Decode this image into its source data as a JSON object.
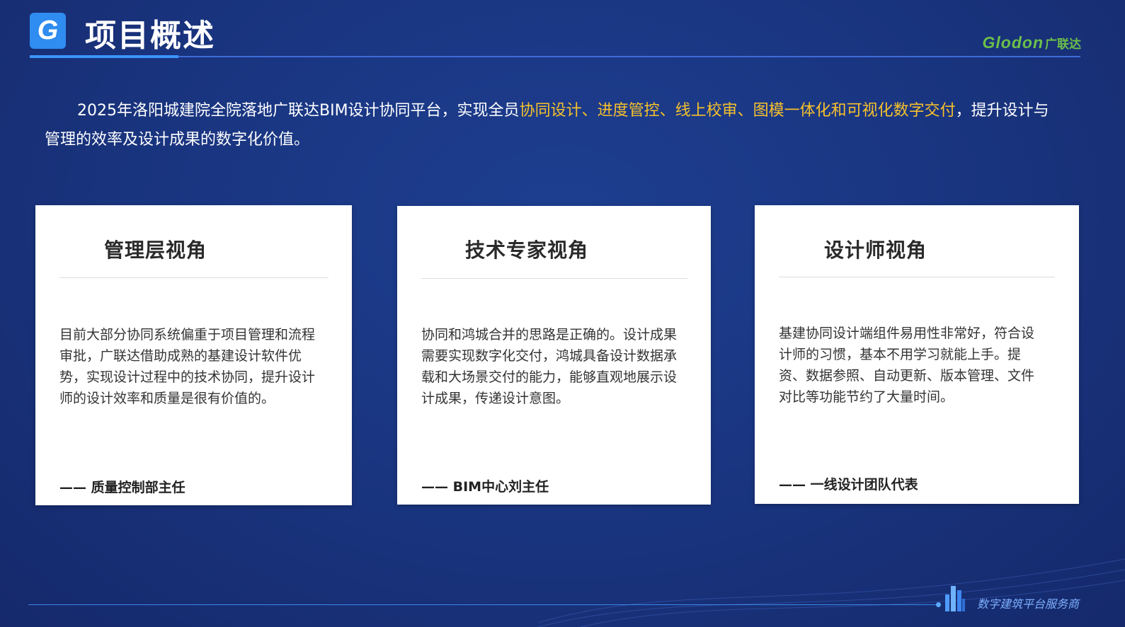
{
  "header": {
    "logo_letter": "G",
    "title": "项目概述",
    "brand_en": "Glodon",
    "brand_cn": "广联达"
  },
  "intro": {
    "text_before": "2025年洛阳城建院全院落地广联达BIM设计协同平台，实现全员",
    "highlight": "协同设计、进度管控、线上校审、图模一体化和可视化数字交付",
    "text_after": "，提升设计与管理的效率及设计成果的数字化价值。",
    "highlight_color": "#f7c12c"
  },
  "cards": [
    {
      "title": "管理层视角",
      "body": "目前大部分协同系统偏重于项目管理和流程审批，广联达借助成熟的基建设计软件优势，实现设计过程中的技术协同，提升设计师的设计效率和质量是很有价值的。",
      "signature": "—— 质量控制部主任"
    },
    {
      "title": "技术专家视角",
      "body": "协同和鸿城合并的思路是正确的。设计成果需要实现数字化交付，鸿城具备设计数据承载和大场景交付的能力，能够直观地展示设计成果，传递设计意图。",
      "signature": "—— BIM中心刘主任"
    },
    {
      "title": "设计师视角",
      "body": "基建协同设计端组件易用性非常好，符合设计师的习惯，基本不用学习就能上手。提资、数据参照、自动更新、版本管理、文件对比等功能节约了大量时间。",
      "signature": "—— 一线设计团队代表"
    }
  ],
  "footer": {
    "tagline": "数字建筑平台服务商"
  }
}
